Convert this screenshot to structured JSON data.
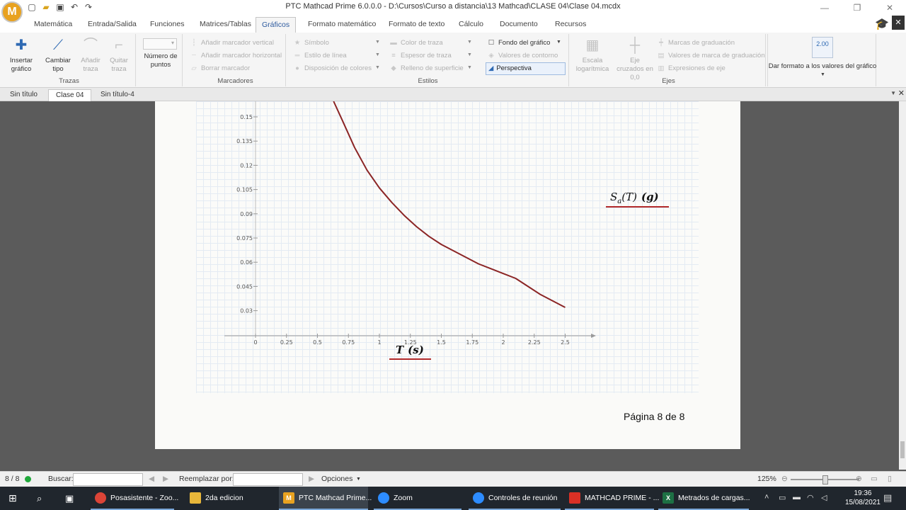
{
  "window": {
    "title": "PTC Mathcad Prime 6.0.0.0 - D:\\Cursos\\Curso a distancia\\13 Mathcad\\CLASE 04\\Clase 04.mcdx",
    "logo_letter": "M"
  },
  "ribbon_tabs": [
    "Matemática",
    "Entrada/Salida",
    "Funciones",
    "Matrices/Tablas",
    "Gráficos",
    "Formato matemático",
    "Formato de texto",
    "Cálculo",
    "Documento",
    "Recursos"
  ],
  "ribbon": {
    "trazas": {
      "label": "Trazas",
      "insertar": "Insertar gráfico",
      "cambiar": "Cambiar tipo",
      "anadir": "Añadir traza",
      "quitar": "Quitar traza"
    },
    "numero_puntos": "Número de puntos",
    "marcadores": {
      "label": "Marcadores",
      "vertical": "Añadir marcador vertical",
      "horizontal": "Añadir marcador horizontal",
      "borrar": "Borrar marcador"
    },
    "estilos": {
      "label": "Estilos",
      "simbolo": "Símbolo",
      "estilo_linea": "Estilo de línea",
      "disposicion": "Disposición de colores",
      "color_traza": "Color de traza",
      "espesor": "Espesor de traza",
      "relleno": "Relleno de superficie",
      "fondo": "Fondo del gráfico",
      "valores_contorno": "Valores de contorno",
      "perspectiva": "Perspectiva"
    },
    "ejes": {
      "label": "Ejes",
      "escala": "Escala logarítmica",
      "eje_cruzados": "Eje cruzados en 0,0",
      "marcas": "Marcas de graduación",
      "valores_marca": "Valores de marca de graduación",
      "expresiones": "Expresiones de eje"
    },
    "formato": {
      "label": "Dar formato a los valores del gráfico",
      "icon_value": "2.00"
    }
  },
  "doc_tabs": [
    "Sin título",
    "Clase 04",
    "Sin título-4"
  ],
  "chart_data": {
    "type": "line",
    "x_ticks": [
      "0",
      "0.25",
      "0.5",
      "0.75",
      "1",
      "1.25",
      "1.5",
      "1.75",
      "2",
      "2.25",
      "2.5"
    ],
    "y_ticks": [
      "0.15",
      "0.135",
      "0.12",
      "0.105",
      "0.09",
      "0.075",
      "0.06",
      "0.045",
      "0.03"
    ],
    "xlim": [
      0,
      2.75
    ],
    "ylim": [
      0.015,
      0.165
    ],
    "xlabel_main": "T",
    "xlabel_arg": "(s)",
    "ylabel_main": "S",
    "ylabel_sub": "a",
    "ylabel_rest": "(T)",
    "ylabel_unit": "(g)",
    "series": [
      {
        "color": "#8b2525",
        "x": [
          0.63,
          0.7,
          0.8,
          0.9,
          1.0,
          1.1,
          1.2,
          1.3,
          1.4,
          1.5,
          1.6,
          1.7,
          1.8,
          1.9,
          2.0,
          2.1,
          2.2,
          2.3,
          2.4,
          2.5
        ],
        "y": [
          0.165,
          0.148,
          0.131,
          0.117,
          0.106,
          0.097,
          0.089,
          0.082,
          0.076,
          0.071,
          0.067,
          0.063,
          0.059,
          0.056,
          0.053,
          0.05,
          0.045,
          0.04,
          0.036,
          0.032
        ]
      }
    ]
  },
  "page_number": "Página 8 de 8",
  "status": {
    "pages": "8 / 8",
    "buscar": "Buscar:",
    "reemplazar": "Reemplazar por:",
    "opciones": "Opciones",
    "zoom": "125%"
  },
  "taskbar": {
    "items": [
      "Posasistente - Zoo...",
      "2da edicion",
      "PTC Mathcad Prime...",
      "Zoom",
      "Controles de reunión",
      "MATHCAD PRIME - ...",
      "Metrados de cargas..."
    ],
    "time": "19:36",
    "date": "15/08/2021"
  },
  "colors": {
    "accent": "#2d5a9e",
    "trace": "#8b2525",
    "label_underline": "#b22a2a"
  }
}
